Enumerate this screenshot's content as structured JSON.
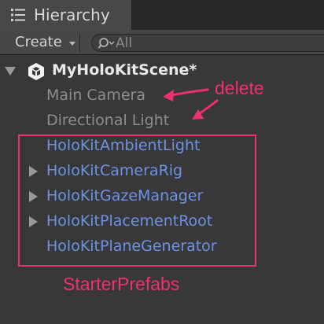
{
  "window": {
    "tab_title": "Hierarchy",
    "tab_icon": "hierarchy-list-icon"
  },
  "toolbar": {
    "create_label": "Create",
    "search_placeholder": "All",
    "search_value": ""
  },
  "hierarchy": {
    "scene": {
      "label": "MyHoloKitScene*",
      "icon": "unity-logo-icon",
      "expanded": true
    },
    "items": [
      {
        "label": "Main Camera",
        "has_children": false,
        "prefab": false
      },
      {
        "label": "Directional Light",
        "has_children": false,
        "prefab": false
      },
      {
        "label": "HoloKitAmbientLight",
        "has_children": false,
        "prefab": true
      },
      {
        "label": "HoloKitCameraRig",
        "has_children": true,
        "prefab": true
      },
      {
        "label": "HoloKitGazeManager",
        "has_children": true,
        "prefab": true
      },
      {
        "label": "HoloKitPlacementRoot",
        "has_children": true,
        "prefab": true
      },
      {
        "label": "HoloKitPlaneGenerator",
        "has_children": false,
        "prefab": true
      }
    ]
  },
  "annotations": {
    "delete_label": "delete",
    "group_label": "StarterPrefabs",
    "color": "#f0306e"
  },
  "colors": {
    "panel_bg": "#383838",
    "prefab_text": "#6d92e6",
    "normal_text": "#8d8d8d"
  }
}
